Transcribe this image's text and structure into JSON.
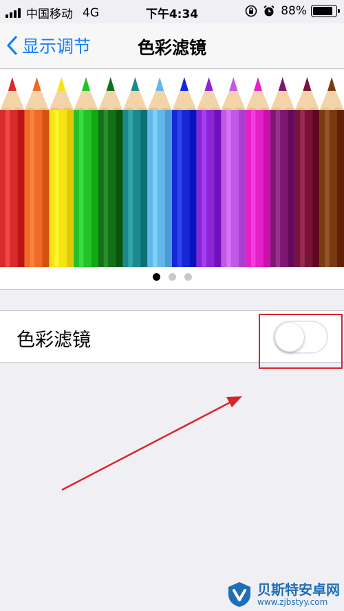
{
  "status_bar": {
    "carrier": "中国移动",
    "network": "4G",
    "time": "下午4:34",
    "battery_percent": "88%",
    "battery_level": 0.88
  },
  "nav": {
    "back_label": "显示调节",
    "title": "色彩滤镜"
  },
  "preview": {
    "pencil_colors": [
      "#d92b2b",
      "#ee6a25",
      "#f7e314",
      "#22c228",
      "#127016",
      "#1a8a8f",
      "#63b6ea",
      "#1428d8",
      "#8a24d6",
      "#c158e6",
      "#e421c6",
      "#7e1772",
      "#7a1239",
      "#7a3a10"
    ],
    "page_count": 3,
    "active_page": 1
  },
  "settings": {
    "row_label": "色彩滤镜",
    "toggle_on": false
  },
  "annotation": {
    "box_color": "#d9252a",
    "arrow_color": "#d9252a"
  },
  "watermark": {
    "title": "贝斯特安卓网",
    "url": "www.zjbstyy.com"
  }
}
